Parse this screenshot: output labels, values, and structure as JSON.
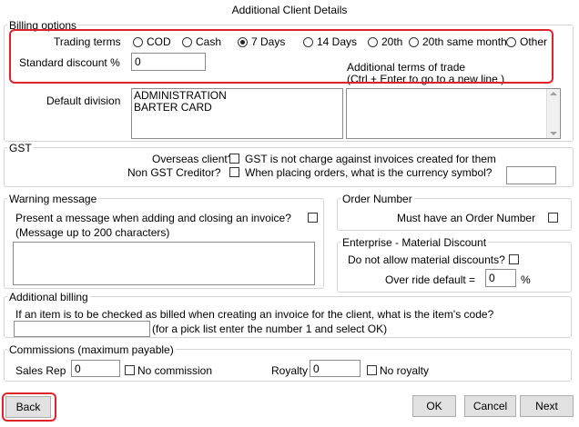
{
  "window": {
    "title": "Additional Client Details"
  },
  "billing_options": {
    "group_label": "Billing options",
    "trading_terms_label": "Trading terms",
    "trading_terms": [
      {
        "label": "COD",
        "selected": false
      },
      {
        "label": "Cash",
        "selected": false
      },
      {
        "label": "7 Days",
        "selected": true
      },
      {
        "label": "14 Days",
        "selected": false
      },
      {
        "label": "20th",
        "selected": false
      },
      {
        "label": "20th same month",
        "selected": false
      },
      {
        "label": "Other",
        "selected": false
      }
    ],
    "standard_discount_label": "Standard discount %",
    "standard_discount_value": "0",
    "additional_terms_label": "Additional terms of trade",
    "additional_terms_hint": "(Ctrl + Enter to go to a new line )",
    "default_division_label": "Default division",
    "divisions": [
      "ADMINISTRATION",
      "BARTER CARD"
    ]
  },
  "gst": {
    "group_label": "GST",
    "overseas_label": "Overseas client?",
    "overseas_desc": "GST is not charge against invoices created for them",
    "non_gst_label": "Non GST Creditor?",
    "non_gst_desc": "When placing orders, what is the currency symbol?",
    "currency_value": ""
  },
  "warning_message": {
    "group_label": "Warning message",
    "present_label": "Present a message when adding and closing an invoice?",
    "hint": "(Message up to 200 characters)",
    "message_value": ""
  },
  "order_number": {
    "group_label": "Order Number",
    "must_have_label": "Must have an Order Number"
  },
  "enterprise": {
    "group_label": "Enterprise - Material Discount",
    "not_allow_label": "Do not allow material discounts?",
    "override_label": "Over ride default =",
    "override_value": "0",
    "percent": "%"
  },
  "additional_billing": {
    "group_label": "Additional billing",
    "question": "If an item is to be checked as billed when creating an invoice for the client, what is the item's code?",
    "pick_hint": "(for a pick list enter the number 1 and select OK)",
    "item_code_value": ""
  },
  "commissions": {
    "group_label": "Commissions (maximum payable)",
    "sales_rep_label": "Sales Rep",
    "sales_rep_value": "0",
    "no_commission_label": "No commission",
    "royalty_label": "Royalty",
    "royalty_value": "0",
    "no_royalty_label": "No royalty"
  },
  "buttons": {
    "back": "Back",
    "ok": "OK",
    "cancel": "Cancel",
    "next": "Next"
  },
  "colors": {
    "highlight": "#e0222c",
    "group_border": "#d4d4d4",
    "button_bg": "#e1e1e1"
  }
}
